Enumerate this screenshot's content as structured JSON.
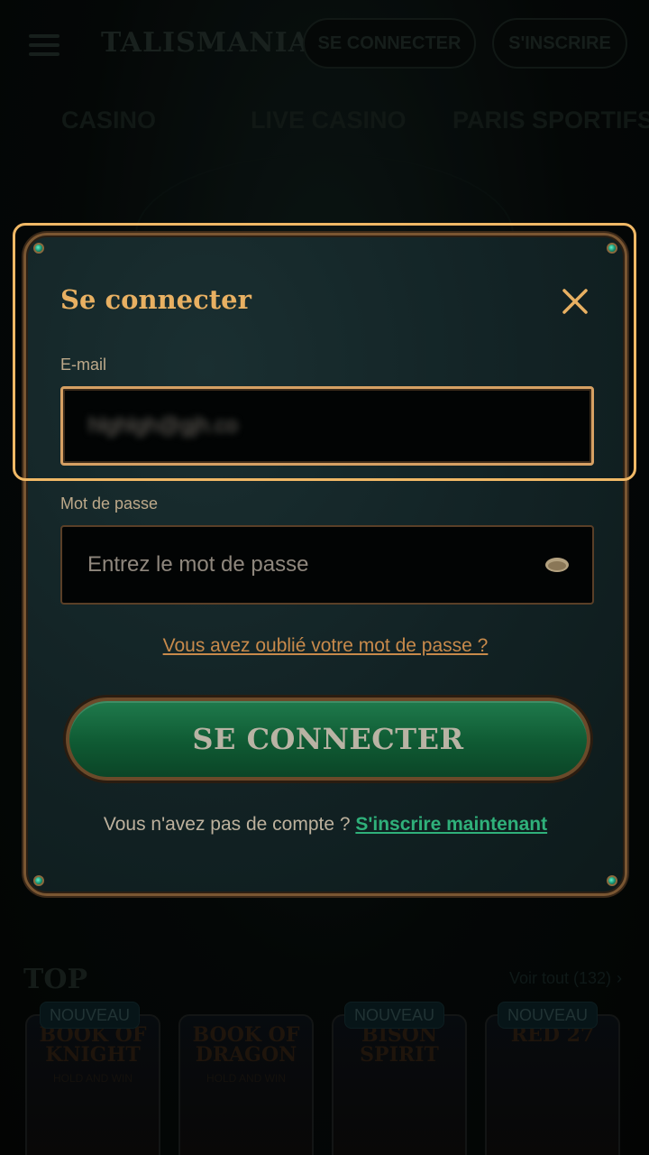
{
  "header": {
    "logo": "TALISMANIA",
    "login_label": "SE CONNECTER",
    "signup_label": "S'INSCRIRE"
  },
  "nav": {
    "items": [
      "CASINO",
      "LIVE CASINO",
      "PARIS SPORTIFS"
    ]
  },
  "top_section": {
    "title": "TOP",
    "see_all": "Voir tout (132)",
    "games": [
      {
        "badge": "NOUVEAU",
        "title": "BOOK OF KNIGHT",
        "sub": "HOLD AND WIN"
      },
      {
        "badge": "",
        "title": "BOOK OF DRAGON",
        "sub": "HOLD AND WIN"
      },
      {
        "badge": "NOUVEAU",
        "title": "BISON SPIRIT",
        "sub": ""
      },
      {
        "badge": "NOUVEAU",
        "title": "RED 27",
        "sub": ""
      }
    ]
  },
  "modal": {
    "title": "Se connecter",
    "email_label": "E-mail",
    "email_value": "hlghlgh@gjh.co",
    "password_label": "Mot de passe",
    "password_placeholder": "Entrez le mot de passe",
    "forgot_link": "Vous avez oublié votre mot de passe ?",
    "submit_label": "SE CONNECTER",
    "no_account_text": "Vous n'avez pas de compte ?",
    "signup_link": "S'inscrire maintenant"
  },
  "colors": {
    "accent_gold": "#e8b062",
    "link_green": "#2fb07a",
    "button_green": "#1f7a4c",
    "highlight": "#f0b866"
  }
}
